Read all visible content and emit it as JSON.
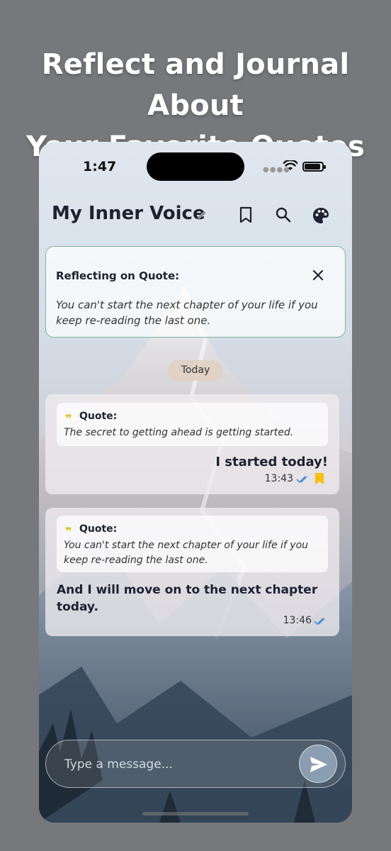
{
  "headline": {
    "line1": "Reflect and Journal About",
    "line2": "Your Favorite Quotes"
  },
  "status_bar": {
    "time": "1:47",
    "dots": "●●●●"
  },
  "header": {
    "title": "My Inner Voice",
    "icons": [
      "edit-icon",
      "bookmark-icon",
      "search-icon",
      "palette-icon"
    ]
  },
  "reflecting": {
    "label": "Reflecting on Quote:",
    "quote": "You can't start the next chapter of your life if you keep re-reading the last one."
  },
  "date_chip": "Today",
  "messages": [
    {
      "quote_mark": "❞",
      "quote_label": "Quote:",
      "quote": "The secret to getting ahead is getting started.",
      "text": "I started today!",
      "time": "13:43",
      "bookmarked": true
    },
    {
      "quote_mark": "❞",
      "quote_label": "Quote:",
      "quote": "You can't start the next chapter of your life if you keep re-reading the last one.",
      "text": "And I will move on to the next chapter today.",
      "time": "13:46",
      "bookmarked": false
    }
  ],
  "composer": {
    "placeholder": "Type a message..."
  },
  "colors": {
    "background": "#77787c",
    "accent_border": "#7fb5a5",
    "quote_icon": "#e6b800",
    "read_ticks": "#4a8fd6",
    "bookmark": "#f4c20d"
  }
}
